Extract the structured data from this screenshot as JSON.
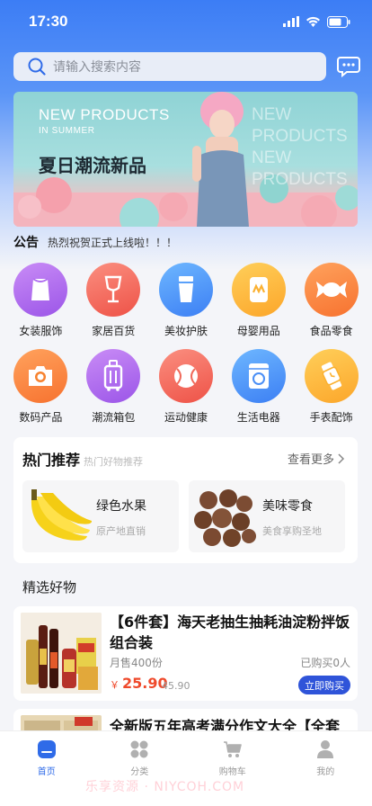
{
  "status_bar": {
    "time": "17:30"
  },
  "search": {
    "placeholder": "请输入搜索内容"
  },
  "banner": {
    "line1": "NEW PRODUCTS",
    "line2": "IN SUMMER",
    "title": "夏日潮流新品",
    "ghost1": "NEW PRODUCTS",
    "ghost2": "NEW PRODUCTS"
  },
  "notice": {
    "tag": "公告",
    "text": "热烈祝贺正式上线啦！！！"
  },
  "categories": [
    {
      "label": "女装服饰",
      "icon": "dress-icon",
      "color_from": "#c98cf6",
      "color_to": "#9b55e8"
    },
    {
      "label": "家居百货",
      "icon": "wine-glass-icon",
      "color_from": "#fb8f80",
      "color_to": "#ee5247"
    },
    {
      "label": "美妆护肤",
      "icon": "cosmetic-tube-icon",
      "color_from": "#6eb7ff",
      "color_to": "#3c7ff4"
    },
    {
      "label": "母婴用品",
      "icon": "baby-bottle-icon",
      "color_from": "#ffcf5a",
      "color_to": "#fca62a"
    },
    {
      "label": "食品零食",
      "icon": "candy-icon",
      "color_from": "#ffa25d",
      "color_to": "#f7722f"
    },
    {
      "label": "数码产品",
      "icon": "camera-icon",
      "color_from": "#ffa25d",
      "color_to": "#f7722f"
    },
    {
      "label": "潮流箱包",
      "icon": "luggage-icon",
      "color_from": "#c98cf6",
      "color_to": "#9b55e8"
    },
    {
      "label": "运动健康",
      "icon": "ball-icon",
      "color_from": "#fb8f80",
      "color_to": "#ee5247"
    },
    {
      "label": "生活电器",
      "icon": "washing-machine-icon",
      "color_from": "#6eb7ff",
      "color_to": "#3c7ff4"
    },
    {
      "label": "手表配饰",
      "icon": "watch-icon",
      "color_from": "#ffcf5a",
      "color_to": "#fca62a"
    }
  ],
  "hot": {
    "title": "热门推荐",
    "subtitle": "热门好物推荐",
    "more": "查看更多",
    "items": [
      {
        "name": "绿色水果",
        "desc": "原产地直销"
      },
      {
        "name": "美味零食",
        "desc": "美食享购圣地"
      }
    ]
  },
  "featured": {
    "title": "精选好物",
    "products": [
      {
        "title": "【6件套】海天老抽生抽耗油淀粉拌饭组合装",
        "sold": "月售400份",
        "bought": "已购买0人",
        "currency": "￥",
        "price": "25.90",
        "original_price": "45.90",
        "buy_label": "立即购买"
      },
      {
        "title": "全新版五年高考满分作文大全【全套"
      }
    ]
  },
  "tabbar": [
    {
      "label": "首页",
      "icon": "home-icon",
      "active": true
    },
    {
      "label": "分类",
      "icon": "category-icon",
      "active": false
    },
    {
      "label": "购物车",
      "icon": "cart-icon",
      "active": false
    },
    {
      "label": "我的",
      "icon": "profile-icon",
      "active": false
    }
  ],
  "watermark": "乐享资源 · NIYCOH.COM",
  "colors": {
    "primary": "#3c7df5",
    "price": "#ef4a2c",
    "buy_button": "#2f54d9"
  }
}
